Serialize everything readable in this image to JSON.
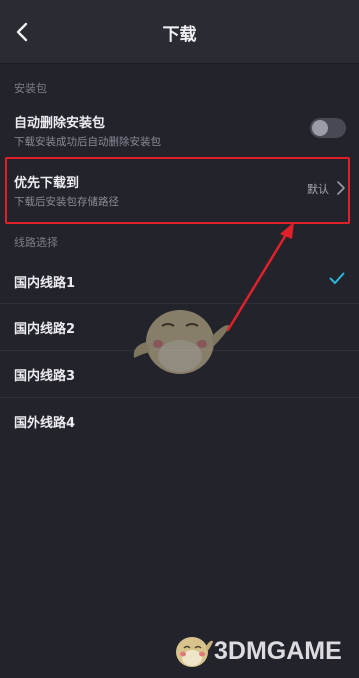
{
  "header": {
    "title": "下载",
    "back_icon": "chevron-left-icon"
  },
  "package_section": {
    "label": "安装包",
    "auto_delete": {
      "title": "自动删除安装包",
      "subtitle": "下载安装成功后自动删除安装包",
      "toggle_on": false
    },
    "download_location": {
      "title": "优先下载到",
      "subtitle": "下载后安装包存储路径",
      "value": "默认"
    }
  },
  "route_section": {
    "label": "线路选择",
    "routes": [
      {
        "label": "国内线路1",
        "selected": true
      },
      {
        "label": "国内线路2",
        "selected": false
      },
      {
        "label": "国内线路3",
        "selected": false
      },
      {
        "label": "国外线路4",
        "selected": false
      }
    ]
  },
  "watermark": {
    "text": "3DMGAME"
  },
  "colors": {
    "background": "#22232b",
    "header": "#2a2b33",
    "accent_check": "#2bb8d8",
    "annotation_red": "#e0212b"
  }
}
